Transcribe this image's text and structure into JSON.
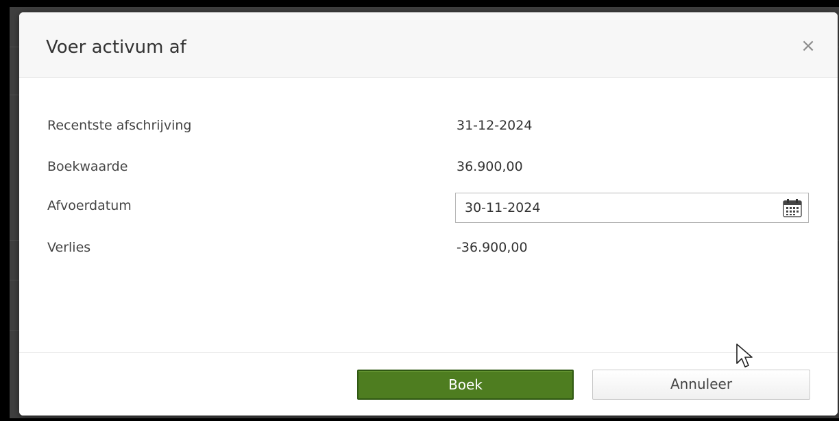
{
  "dialog": {
    "title": "Voer activum af",
    "close_symbol": "×"
  },
  "fields": {
    "recentste_afschrijving": {
      "label": "Recentste afschrijving",
      "value": "31-12-2024"
    },
    "boekwaarde": {
      "label": "Boekwaarde",
      "value": "36.900,00"
    },
    "afvoerdatum": {
      "label": "Afvoerdatum",
      "value": "30-11-2024",
      "icon": "calendar-icon"
    },
    "verlies": {
      "label": "Verlies",
      "value": "-36.900,00"
    }
  },
  "footer": {
    "book_label": "Boek",
    "cancel_label": "Annuleer"
  },
  "colors": {
    "primary_button": "#4e7d20",
    "header_background": "#f7f7f7"
  }
}
